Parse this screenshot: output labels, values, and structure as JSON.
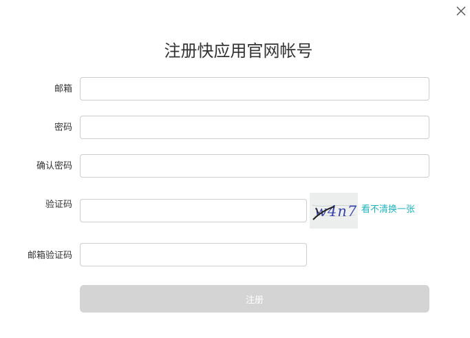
{
  "dialog": {
    "title": "注册快应用官网帐号",
    "close_icon": "close-icon"
  },
  "form": {
    "email_label": "邮箱",
    "email_value": "",
    "password_label": "密码",
    "password_value": "",
    "confirm_password_label": "确认密码",
    "confirm_password_value": "",
    "captcha_label": "验证码",
    "captcha_value": "",
    "captcha_image_text": "w4n7",
    "captcha_refresh_label": "看不清换一张",
    "email_code_label": "邮箱验证码",
    "email_code_value": "",
    "submit_label": "注册"
  },
  "colors": {
    "link": "#20b2bd",
    "button_disabled": "#d4d4d4",
    "border": "#cccccc"
  }
}
